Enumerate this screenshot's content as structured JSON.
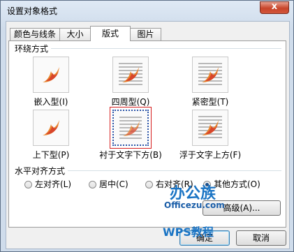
{
  "window": {
    "title": "设置对象格式",
    "close_label": "x"
  },
  "tabs": [
    {
      "label": "颜色与线条"
    },
    {
      "label": "大小"
    },
    {
      "label": "版式"
    },
    {
      "label": "图片"
    }
  ],
  "active_tab": "版式",
  "wrap_section": {
    "label": "环绕方式",
    "options": [
      {
        "label": "嵌入型(I)"
      },
      {
        "label": "四周型(Q)"
      },
      {
        "label": "紧密型(T)"
      },
      {
        "label": "上下型(P)"
      },
      {
        "label": "衬于文字下方(B)"
      },
      {
        "label": "浮于文字上方(F)"
      }
    ],
    "selected": "衬于文字下方(B)"
  },
  "align_section": {
    "label": "水平对齐方式",
    "options": [
      {
        "label": "左对齐(L)"
      },
      {
        "label": "居中(C)"
      },
      {
        "label": "右对齐(R)"
      },
      {
        "label": "其他方式(O)"
      }
    ],
    "selected": "其他方式(O)"
  },
  "buttons": {
    "advanced": "高级(A)...",
    "ok": "确定",
    "cancel": "取消"
  },
  "watermark": {
    "line1": "办公族",
    "line2": "Officezu.com",
    "line3": "WPS教程"
  },
  "colors": {
    "accent": "#2b55a8",
    "selection_outline": "#d61f1f",
    "close": "#c8452b"
  },
  "icons": {
    "picture": "picture-flame-icon"
  }
}
